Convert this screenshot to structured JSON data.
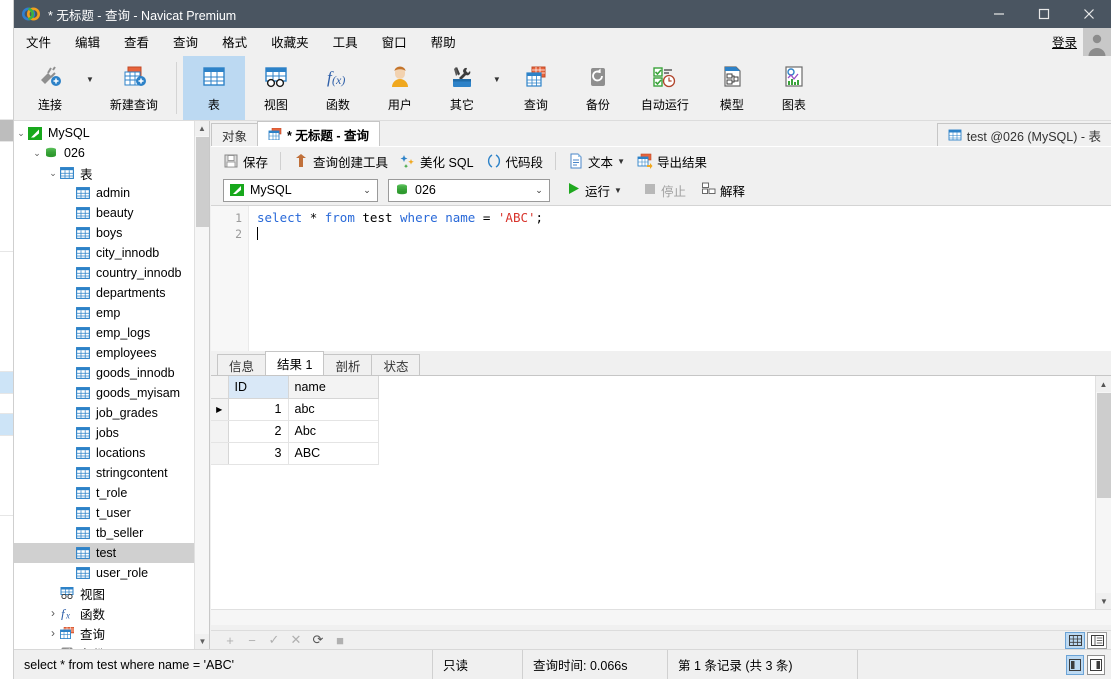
{
  "window": {
    "title": "* 无标题 - 查询 - Navicat Premium",
    "minimize": "—",
    "maximize": "☐",
    "close": "✕"
  },
  "menubar": {
    "items": [
      "文件",
      "编辑",
      "查看",
      "查询",
      "格式",
      "收藏夹",
      "工具",
      "窗口",
      "帮助"
    ],
    "login_label": "登录"
  },
  "ribbon": {
    "left_group": [
      {
        "label": "连接",
        "icon": "connection-icon",
        "caret": true
      },
      {
        "label": "新建查询",
        "icon": "new-query-icon",
        "caret": false
      }
    ],
    "main_group": [
      {
        "label": "表",
        "icon": "table-icon",
        "active": true,
        "caret": false
      },
      {
        "label": "视图",
        "icon": "view-icon",
        "active": false,
        "caret": false
      },
      {
        "label": "函数",
        "icon": "function-icon",
        "active": false,
        "caret": false
      },
      {
        "label": "用户",
        "icon": "user-icon",
        "active": false,
        "caret": false
      },
      {
        "label": "其它",
        "icon": "other-icon",
        "active": false,
        "caret": true
      },
      {
        "label": "查询",
        "icon": "query-icon",
        "active": false,
        "caret": false
      },
      {
        "label": "备份",
        "icon": "backup-icon",
        "active": false,
        "caret": false
      },
      {
        "label": "自动运行",
        "icon": "automation-icon",
        "active": false,
        "caret": false
      },
      {
        "label": "模型",
        "icon": "model-icon",
        "active": false,
        "caret": false
      },
      {
        "label": "图表",
        "icon": "chart-icon",
        "active": false,
        "caret": false
      }
    ]
  },
  "sidebar": {
    "tree": [
      {
        "label": "MySQL",
        "depth": 0,
        "twist": "v",
        "icon": "mysql-connection-icon",
        "selected": false
      },
      {
        "label": "026",
        "depth": 1,
        "twist": "v",
        "icon": "database-icon",
        "selected": false
      },
      {
        "label": "表",
        "depth": 2,
        "twist": "v",
        "icon": "tables-folder-icon",
        "selected": false
      },
      {
        "label": "admin",
        "depth": 3,
        "twist": "",
        "icon": "table-icon",
        "selected": false
      },
      {
        "label": "beauty",
        "depth": 3,
        "twist": "",
        "icon": "table-icon",
        "selected": false
      },
      {
        "label": "boys",
        "depth": 3,
        "twist": "",
        "icon": "table-icon",
        "selected": false
      },
      {
        "label": "city_innodb",
        "depth": 3,
        "twist": "",
        "icon": "table-icon",
        "selected": false
      },
      {
        "label": "country_innodb",
        "depth": 3,
        "twist": "",
        "icon": "table-icon",
        "selected": false
      },
      {
        "label": "departments",
        "depth": 3,
        "twist": "",
        "icon": "table-icon",
        "selected": false
      },
      {
        "label": "emp",
        "depth": 3,
        "twist": "",
        "icon": "table-icon",
        "selected": false
      },
      {
        "label": "emp_logs",
        "depth": 3,
        "twist": "",
        "icon": "table-icon",
        "selected": false
      },
      {
        "label": "employees",
        "depth": 3,
        "twist": "",
        "icon": "table-icon",
        "selected": false
      },
      {
        "label": "goods_innodb",
        "depth": 3,
        "twist": "",
        "icon": "table-icon",
        "selected": false
      },
      {
        "label": "goods_myisam",
        "depth": 3,
        "twist": "",
        "icon": "table-icon",
        "selected": false
      },
      {
        "label": "job_grades",
        "depth": 3,
        "twist": "",
        "icon": "table-icon",
        "selected": false
      },
      {
        "label": "jobs",
        "depth": 3,
        "twist": "",
        "icon": "table-icon",
        "selected": false
      },
      {
        "label": "locations",
        "depth": 3,
        "twist": "",
        "icon": "table-icon",
        "selected": false
      },
      {
        "label": "stringcontent",
        "depth": 3,
        "twist": "",
        "icon": "table-icon",
        "selected": false
      },
      {
        "label": "t_role",
        "depth": 3,
        "twist": "",
        "icon": "table-icon",
        "selected": false
      },
      {
        "label": "t_user",
        "depth": 3,
        "twist": "",
        "icon": "table-icon",
        "selected": false
      },
      {
        "label": "tb_seller",
        "depth": 3,
        "twist": "",
        "icon": "table-icon",
        "selected": false
      },
      {
        "label": "test",
        "depth": 3,
        "twist": "",
        "icon": "table-icon",
        "selected": true
      },
      {
        "label": "user_role",
        "depth": 3,
        "twist": "",
        "icon": "table-icon",
        "selected": false
      },
      {
        "label": "视图",
        "depth": 2,
        "twist": "",
        "icon": "view-icon",
        "selected": false
      },
      {
        "label": "函数",
        "depth": 2,
        "twist": ">",
        "icon": "function-icon",
        "selected": false
      },
      {
        "label": "查询",
        "depth": 2,
        "twist": ">",
        "icon": "query-icon",
        "selected": false
      },
      {
        "label": "备份",
        "depth": 2,
        "twist": ">",
        "icon": "backup-icon",
        "selected": false
      }
    ]
  },
  "tabs": [
    {
      "label": "对象",
      "icon": "",
      "active": false
    },
    {
      "label": "* 无标题 - 查询",
      "icon": "query-tab-icon",
      "active": true
    },
    {
      "label": "test @026 (MySQL) - 表",
      "icon": "table-tab-icon",
      "active": false
    }
  ],
  "query_toolbar": {
    "buttons": [
      {
        "label": "保存",
        "icon": "save-icon",
        "caret": false
      },
      {
        "label": "查询创建工具",
        "icon": "builder-icon",
        "caret": false
      },
      {
        "label": "美化 SQL",
        "icon": "beautify-icon",
        "caret": false
      },
      {
        "label": "代码段",
        "icon": "snippet-icon",
        "caret": false
      },
      {
        "label": "文本",
        "icon": "text-icon",
        "caret": true
      },
      {
        "label": "导出结果",
        "icon": "export-icon",
        "caret": false
      }
    ]
  },
  "connection_row": {
    "connection": "MySQL",
    "database": "026",
    "run_label": "运行",
    "stop_label": "停止",
    "explain_label": "解释"
  },
  "editor": {
    "line_numbers": [
      "1",
      "2"
    ],
    "sql_tokens": [
      [
        {
          "t": "select",
          "c": "kw"
        },
        {
          "t": " ",
          "c": "op"
        },
        {
          "t": "*",
          "c": "op"
        },
        {
          "t": " ",
          "c": "op"
        },
        {
          "t": "from",
          "c": "kw"
        },
        {
          "t": " ",
          "c": "op"
        },
        {
          "t": "test",
          "c": "id"
        },
        {
          "t": " ",
          "c": "op"
        },
        {
          "t": "where",
          "c": "kw"
        },
        {
          "t": " ",
          "c": "op"
        },
        {
          "t": "name",
          "c": "kw"
        },
        {
          "t": " ",
          "c": "op"
        },
        {
          "t": "=",
          "c": "op"
        },
        {
          "t": " ",
          "c": "op"
        },
        {
          "t": "'ABC'",
          "c": "str"
        },
        {
          "t": ";",
          "c": "op"
        }
      ],
      []
    ],
    "full_sql": "select * from test where name = 'ABC';"
  },
  "result_tabs": [
    {
      "label": "信息",
      "active": false
    },
    {
      "label": "结果 1",
      "active": true
    },
    {
      "label": "剖析",
      "active": false
    },
    {
      "label": "状态",
      "active": false
    }
  ],
  "result_grid": {
    "columns": [
      "ID",
      "name"
    ],
    "selected_column": "ID",
    "current_row": 1,
    "rows": [
      {
        "ID": "1",
        "name": "abc"
      },
      {
        "ID": "2",
        "name": "Abc"
      },
      {
        "ID": "3",
        "name": "ABC"
      }
    ]
  },
  "nav_bar": {
    "buttons": [
      {
        "icon": "add-record-icon",
        "label": "+",
        "enabled": false
      },
      {
        "icon": "remove-record-icon",
        "label": "−",
        "enabled": false
      },
      {
        "icon": "apply-change-icon",
        "label": "✓",
        "enabled": false
      },
      {
        "icon": "cancel-change-icon",
        "label": "✕",
        "enabled": false
      },
      {
        "icon": "refresh-icon",
        "label": "⟳",
        "enabled": true
      },
      {
        "icon": "stop-icon",
        "label": "■",
        "enabled": false
      }
    ],
    "view_toggle": [
      {
        "icon": "grid-view-icon",
        "selected": true
      },
      {
        "icon": "form-view-icon",
        "selected": false
      }
    ]
  },
  "statusbar": {
    "sql": "select * from test where name = 'ABC'",
    "readonly": "只读",
    "query_time": "查询时间: 0.066s",
    "record_info": "第 1 条记录 (共 3 条)",
    "panel_toggles": [
      {
        "icon": "left-panel-icon",
        "selected": true
      },
      {
        "icon": "right-panel-icon",
        "selected": false
      }
    ]
  },
  "colors": {
    "titlebar": "#4a5561",
    "accent_blue": "#2d82c8",
    "ribbon_active": "#bcd9f2",
    "keyword": "#2969d8",
    "string": "#d8342c",
    "selection_gray": "#d0d0d0"
  }
}
